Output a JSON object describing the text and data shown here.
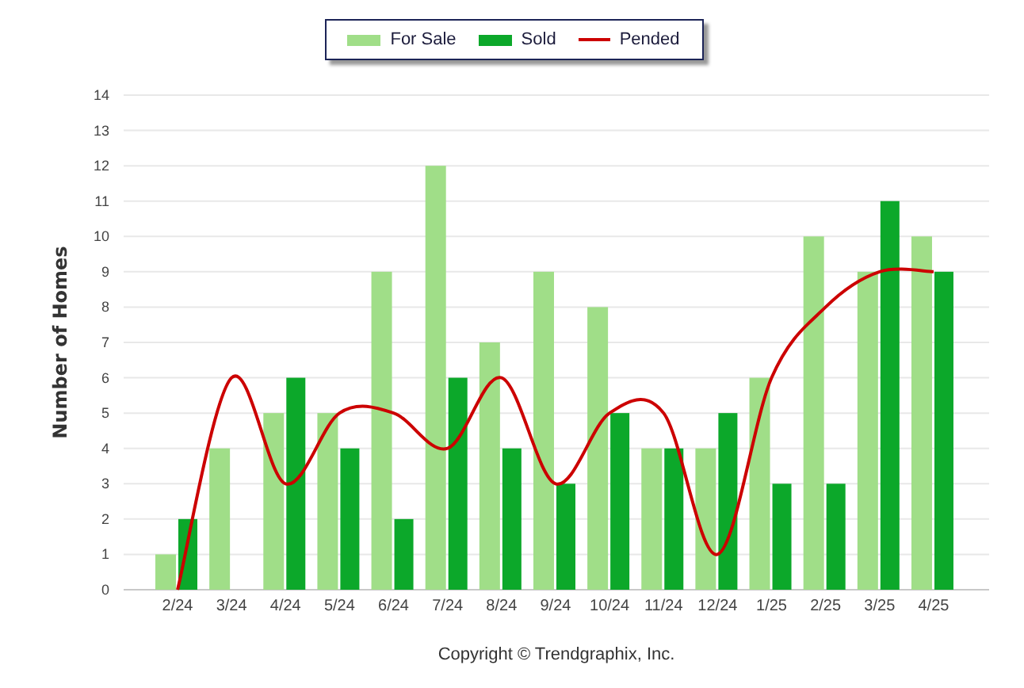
{
  "chart_data": {
    "type": "bar",
    "ylabel": "Number of Homes",
    "categories": [
      "2/24",
      "3/24",
      "4/24",
      "5/24",
      "6/24",
      "7/24",
      "8/24",
      "9/24",
      "10/24",
      "11/24",
      "12/24",
      "1/25",
      "2/25",
      "3/25",
      "4/25"
    ],
    "series": [
      {
        "name": "For Sale",
        "type": "bar",
        "color": "#a0de88",
        "values": [
          1,
          4,
          5,
          5,
          9,
          12,
          7,
          9,
          8,
          4,
          4,
          6,
          10,
          9,
          10
        ]
      },
      {
        "name": "Sold",
        "type": "bar",
        "color": "#0ca82a",
        "values": [
          2,
          0,
          6,
          4,
          2,
          6,
          4,
          3,
          5,
          4,
          5,
          3,
          3,
          11,
          9
        ]
      },
      {
        "name": "Pended",
        "type": "line",
        "color": "#cc0000",
        "values": [
          0,
          6,
          3,
          5,
          5,
          4,
          6,
          3,
          5,
          5,
          1,
          6,
          8,
          9,
          9
        ]
      }
    ],
    "grid": true,
    "ylim": [
      0,
      14
    ],
    "yticks": [
      0,
      1,
      2,
      3,
      4,
      5,
      6,
      7,
      8,
      9,
      10,
      11,
      12,
      13,
      14
    ]
  },
  "footer": "Copyright © Trendgraphix, Inc."
}
